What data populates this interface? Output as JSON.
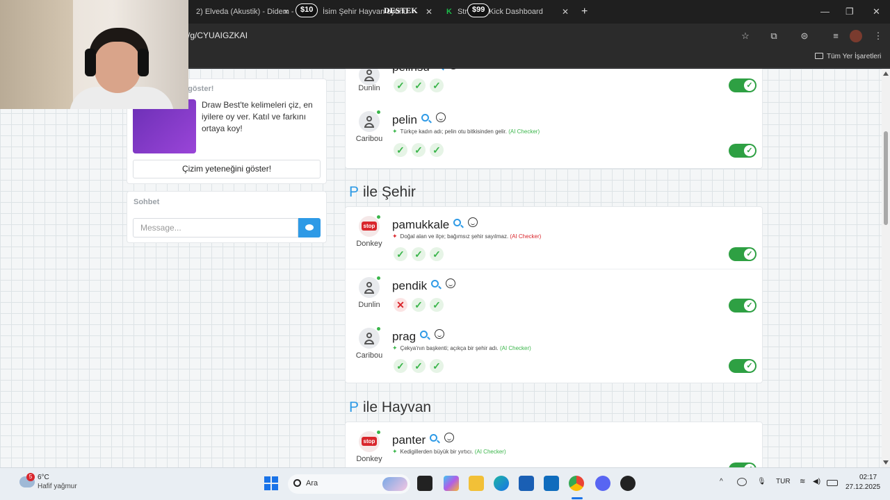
{
  "browser": {
    "tabs": [
      {
        "label": "2) Elveda (Akustik) - Didem - Y"
      },
      {
        "label": "İsim Şehir Hayvan oyunu"
      },
      {
        "label": "Stream - Kick Dashboard"
      }
    ],
    "overlay": {
      "badge1": "$10",
      "badge2": "$99",
      "support": "DESTEK"
    },
    "url": "/g/CYUAIGZKAI",
    "bookmarks_all": "Tüm Yer İşaretleri"
  },
  "sidebar": {
    "promo_title": "i göster!",
    "promo_text": "Draw Best'te kelimeleri çiz, en iyilere oy ver. Katıl ve farkını ortaya koy!",
    "promo_button": "Çizim yeteneğini göster!",
    "chat_title": "Sohbet",
    "chat_placeholder": "Message..."
  },
  "sections": [
    {
      "letter": "P",
      "title": "ile Şehir"
    },
    {
      "letter": "P",
      "title": "ile Hayvan"
    }
  ],
  "rows": {
    "pelinsu": {
      "word": "pelinsu",
      "user": "Dunlin",
      "votes": [
        "yes",
        "yes",
        "yes"
      ],
      "enabled": true
    },
    "pelin": {
      "word": "pelin",
      "user": "Caribou",
      "note": "Türkçe kadın adı; pelin otu bitkisinden gelir.",
      "checker": "(AI Checker)",
      "votes": [
        "yes",
        "yes",
        "yes"
      ],
      "enabled": true
    },
    "pamukkale": {
      "word": "pamukkale",
      "user": "Donkey",
      "note": "Doğal alan ve ilçe; bağımsız şehir sayılmaz.",
      "checker": "(AI Checker)",
      "votes": [
        "yes",
        "yes",
        "yes"
      ],
      "enabled": true
    },
    "pendik": {
      "word": "pendik",
      "user": "Dunlin",
      "votes": [
        "no",
        "yes",
        "yes"
      ],
      "enabled": true
    },
    "prag": {
      "word": "prag",
      "user": "Caribou",
      "note": "Çekya'nın başkenti; açıkça bir şehir adı.",
      "checker": "(AI Checker)",
      "votes": [
        "yes",
        "yes",
        "yes"
      ],
      "enabled": true
    },
    "panter": {
      "word": "panter",
      "user": "Donkey",
      "note": "Kedigillerden büyük bir yırtıcı.",
      "checker": "(AI Checker)",
      "votes": [
        "yes",
        "yes",
        "yes"
      ],
      "enabled": true
    }
  },
  "stop_label": "stop",
  "taskbar": {
    "weather_badge": "5",
    "weather_temp": "6°C",
    "weather_desc": "Hafif yağmur",
    "search_label": "Ara",
    "lang": "TUR",
    "time": "02:17",
    "date": "27.12.2025"
  },
  "colors": {
    "accent": "#2e9ae6",
    "success": "#2ea043",
    "danger": "#d9262c"
  }
}
